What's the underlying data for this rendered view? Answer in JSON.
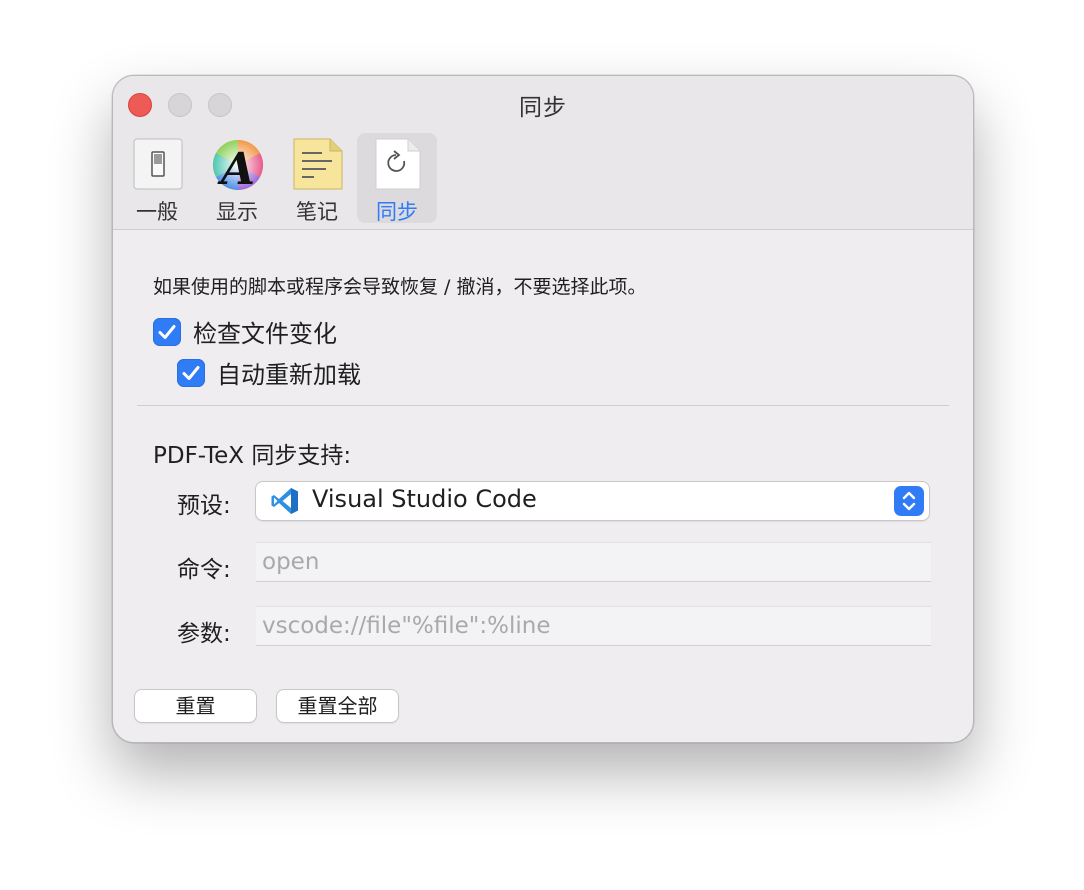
{
  "window": {
    "title": "同步"
  },
  "toolbar": {
    "items": [
      {
        "label": "一般",
        "icon": "switch-icon"
      },
      {
        "label": "显示",
        "icon": "font-color-icon"
      },
      {
        "label": "笔记",
        "icon": "note-icon"
      },
      {
        "label": "同步",
        "icon": "sync-document-icon",
        "active": true
      }
    ]
  },
  "sync": {
    "description": "如果使用的脚本或程序会导致恢复 / 撤消，不要选择此项。",
    "check_file_changes": {
      "label": "检查文件变化",
      "checked": true
    },
    "auto_reload": {
      "label": "自动重新加载",
      "checked": true
    },
    "section_title": "PDF-TeX 同步支持:",
    "preset": {
      "label": "预设:",
      "value": "Visual Studio Code",
      "icon": "vscode-icon"
    },
    "command": {
      "label": "命令:",
      "placeholder": "open"
    },
    "arguments": {
      "label": "参数:",
      "placeholder": "vscode://file\"%file\":%line"
    }
  },
  "buttons": {
    "reset": "重置",
    "reset_all": "重置全部"
  },
  "colors": {
    "accent": "#2f7cf6",
    "close": "#ee5b57"
  }
}
